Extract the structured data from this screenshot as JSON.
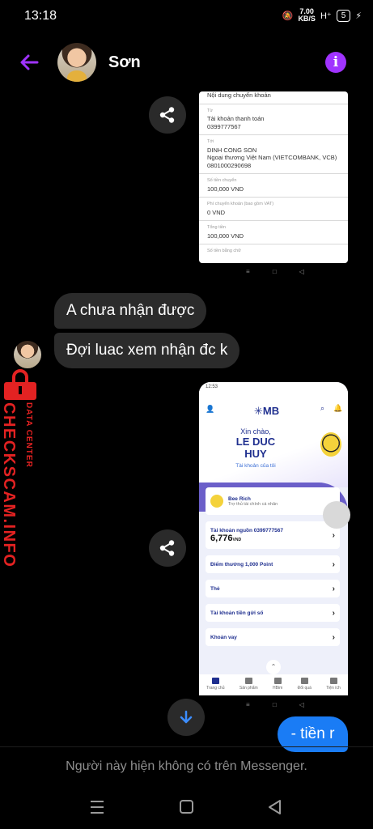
{
  "status_bar": {
    "time": "13:18",
    "net_speed_value": "7.00",
    "net_speed_unit": "KB/S",
    "network": "H⁺",
    "battery": "5"
  },
  "header": {
    "contact_name": "Sơn",
    "back_icon": "back-arrow-icon",
    "info_icon": "info-icon"
  },
  "receipt": {
    "header": "Nội dung chuyển khoản",
    "from_label": "Từ",
    "from_account": "Tài khoản thanh toán",
    "from_number": "0399777567",
    "to_label": "Tới",
    "to_name": "DINH CONG SON",
    "to_bank": "Ngoại thương Việt Nam (VIETCOMBANK, VCB)",
    "to_number": "0801000290698",
    "amount_label": "Số tiền chuyển",
    "amount": "100,000 VND",
    "fee_label": "Phí chuyển khoản (bao gồm VAT)",
    "fee": "0 VND",
    "total_label": "Tổng tiền",
    "total": "100,000 VND",
    "more_label": "Số tiền bằng chữ"
  },
  "messages": [
    {
      "text": "A chưa nhận được"
    },
    {
      "text": "Đợi luac xem nhận đc k"
    }
  ],
  "watermark": {
    "brand": "CHECKSCAM.INFO",
    "tag": "DATA CENTER"
  },
  "mb_app": {
    "status_time": "12:53",
    "logo": "MB",
    "greeting": "Xin chào,",
    "name_line1": "LE DUC",
    "name_line2": "HUY",
    "account_link": "Tài khoản của tôi",
    "bee_rich_title": "Bee Rich",
    "bee_rich_sub": "Trợ thủ tài chính cá nhân",
    "account_label": "Tài khoản nguồn 0399777567",
    "balance": "6,776",
    "balance_unit": "VND",
    "menu": [
      "Điểm thưởng 1,000 Point",
      "Thẻ",
      "Tài khoản tiền gửi số",
      "Khoản vay"
    ],
    "tabs": [
      "Trang chủ",
      "Sản phẩm",
      "HBim",
      "Đổi quà",
      "Tiện ích"
    ]
  },
  "sent_message": "- tiền r",
  "footer_notice": "Người này hiện không có trên Messenger.",
  "colors": {
    "accent": "#a033ff",
    "sent_bubble": "#1a7cf5",
    "received_bubble": "#2b2b2b",
    "watermark": "#e32222"
  }
}
